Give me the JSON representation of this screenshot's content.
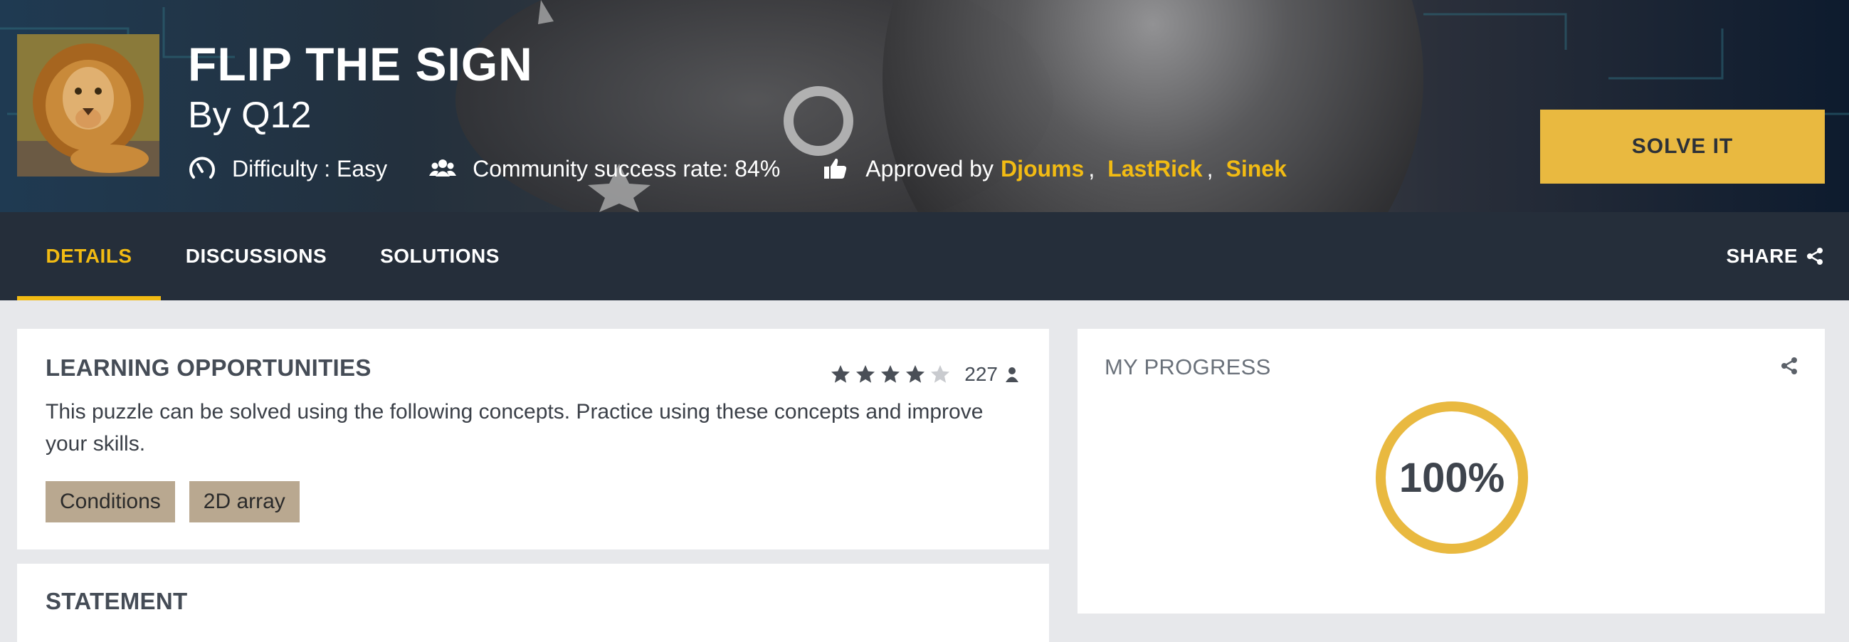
{
  "puzzle": {
    "title": "FLIP THE SIGN",
    "author": "By Q12",
    "difficulty": "Difficulty : Easy",
    "success_rate": "Community success rate: 84%",
    "approved_prefix": "Approved by",
    "approvers": [
      "Djoums",
      "LastRick",
      "Sinek"
    ],
    "separator": ","
  },
  "hero_icons": {
    "difficulty": "gauge-icon",
    "community": "users-icon",
    "approved": "thumbs-up-icon",
    "avatar": "lion-avatar"
  },
  "solve_button": {
    "label": "SOLVE IT"
  },
  "nav": {
    "tabs": [
      {
        "label": "DETAILS",
        "active": true
      },
      {
        "label": "DISCUSSIONS",
        "active": false
      },
      {
        "label": "SOLUTIONS",
        "active": false
      }
    ],
    "share_label": "SHARE"
  },
  "learning": {
    "heading": "LEARNING OPPORTUNITIES",
    "rating_stars": 4,
    "rating_max": 5,
    "rating_count": "227",
    "description": "This puzzle can be solved using the following concepts. Practice using these concepts and improve your skills.",
    "tags": [
      "Conditions",
      "2D array"
    ]
  },
  "statement": {
    "heading": "STATEMENT"
  },
  "progress": {
    "heading": "MY PROGRESS",
    "value": "100%",
    "fraction": 1.0
  },
  "colors": {
    "accent": "#f2bb13",
    "button": "#e9b940",
    "nav_bg": "#252e3a",
    "tag_bg": "#b9a890",
    "ring": "#e9b940"
  }
}
